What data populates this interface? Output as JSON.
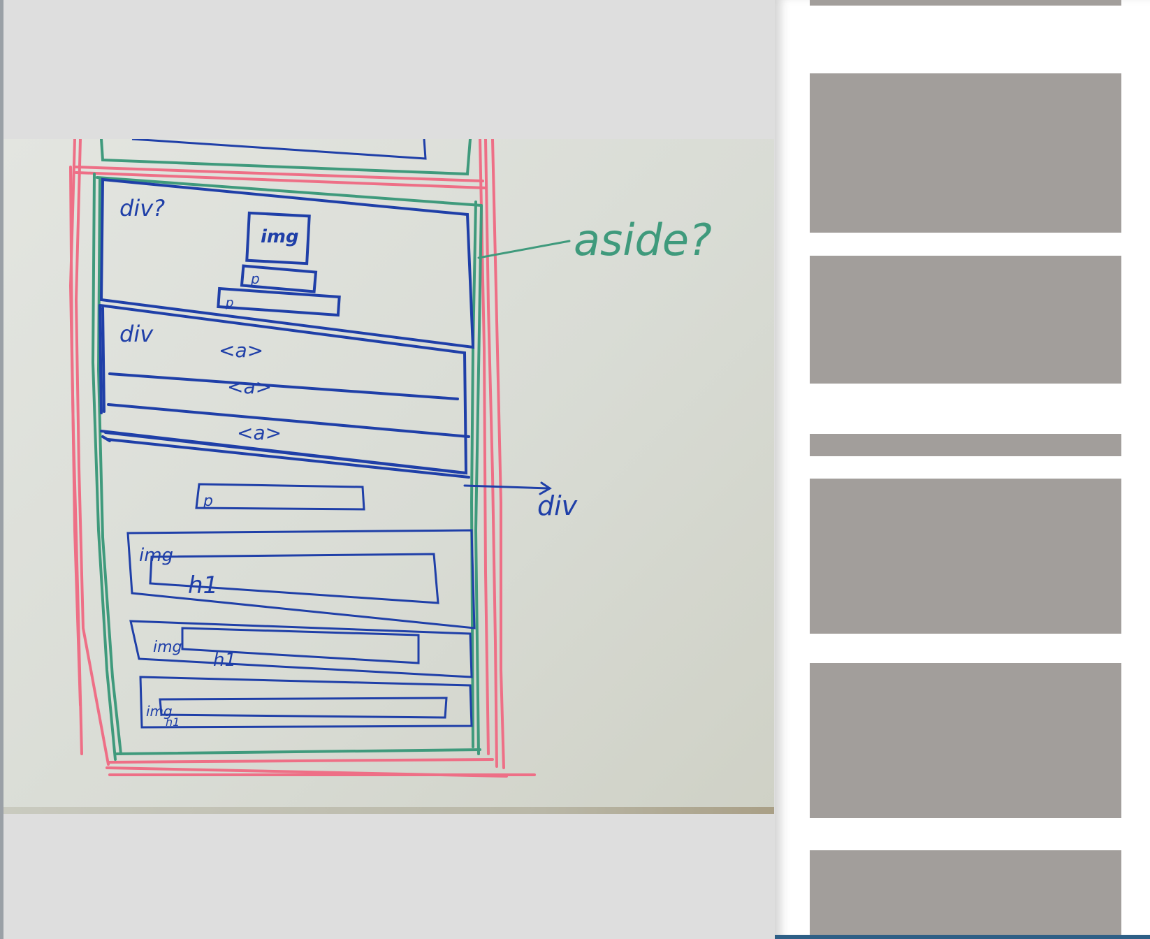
{
  "image_viewer": {
    "photo_subject": "whiteboard-wireframe-sketch",
    "sketch_labels": {
      "div_question": "div?",
      "img_top": "img",
      "p_small_1": "p",
      "p_small_2": "p",
      "div_label": "div",
      "a_1": "<a>",
      "a_2": "<a>",
      "a_3": "<a>",
      "aside_annotation": "aside?",
      "div_annotation": "div",
      "p_mid": "p",
      "img_card_1": "img",
      "h1_card_1": "h1",
      "img_card_2": "img",
      "h1_card_2": "h1",
      "img_card_3": "img",
      "h1_card_3": "h1"
    },
    "marker_colors": {
      "blue": "#1f3fa8",
      "green": "#3f9a7c",
      "pink": "#ee6f86"
    }
  },
  "sidebar": {
    "placeholder_color": "#a29e9b",
    "placeholder_count": 8
  }
}
